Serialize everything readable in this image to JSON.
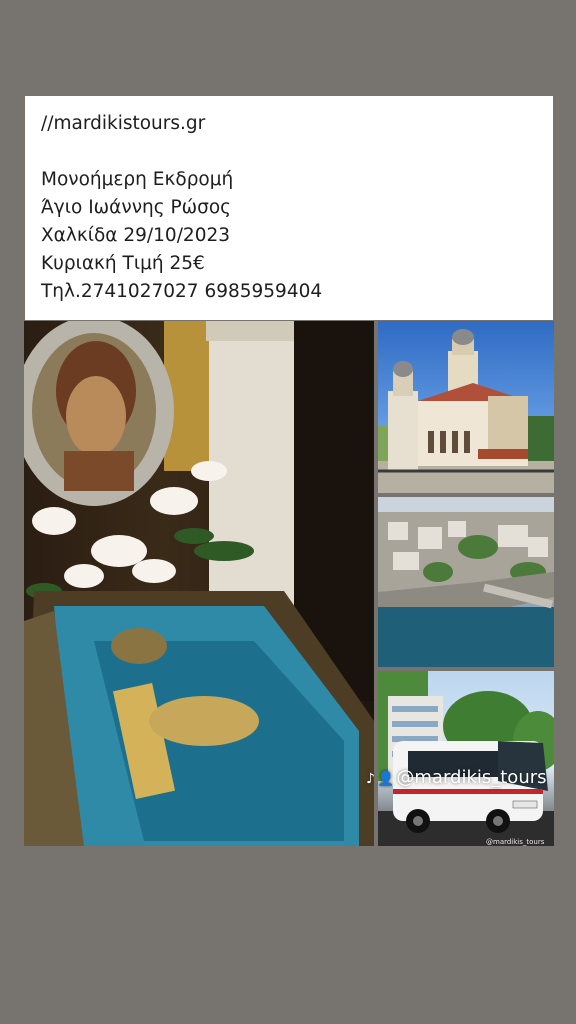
{
  "post": {
    "url": "//mardikistours.gr",
    "lines": [
      "Μονοήμερη Εκδρομή",
      "Άγιο Ιωάννης Ρώσος",
      "Χαλκίδα  29/10/2023",
      "Κυριακή  Τιμή 25€",
      "Τηλ.2741027027 6985959404"
    ]
  },
  "watermark": {
    "handle": "@mardikis_tours",
    "small": "@mardikis_tours"
  },
  "icons": [
    "tiktok-icon",
    "user-icon"
  ],
  "colors": {
    "background": "#77736e",
    "card": "#ffffff",
    "text": "#1e1e1e"
  }
}
